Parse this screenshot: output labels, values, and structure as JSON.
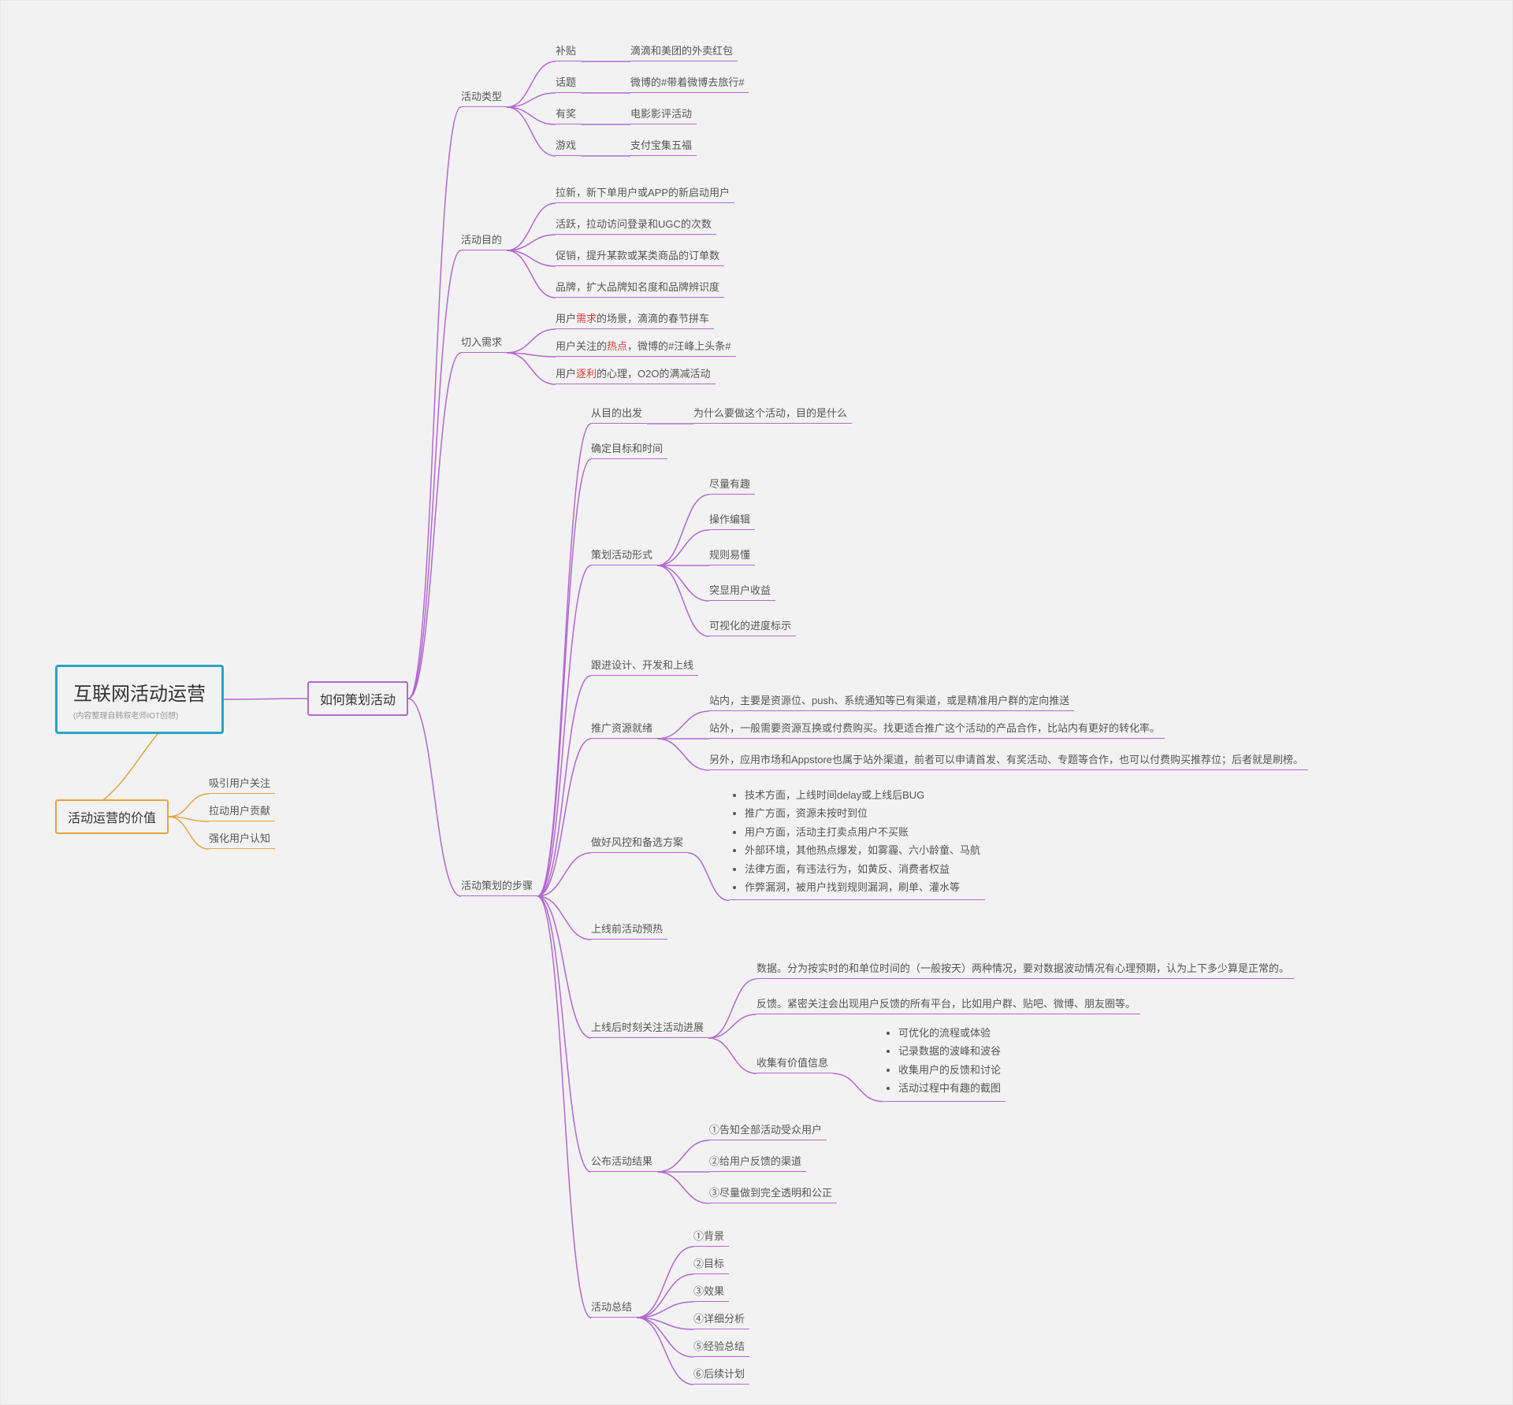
{
  "root": {
    "title": "互联网活动运营",
    "subtitle": "(内容整理自韩叙老师IOT创想)"
  },
  "how": {
    "label": "如何策划活动",
    "type": {
      "label": "活动类型",
      "items": [
        {
          "k": "补贴",
          "v": "滴滴和美团的外卖红包"
        },
        {
          "k": "话题",
          "v": "微博的#带着微博去旅行#"
        },
        {
          "k": "有奖",
          "v": "电影影评活动"
        },
        {
          "k": "游戏",
          "v": "支付宝集五福"
        }
      ]
    },
    "purpose": {
      "label": "活动目的",
      "items": [
        "拉新，新下单用户或APP的新启动用户",
        "活跃，拉动访问登录和UGC的次数",
        "促销，提升某款或某类商品的订单数",
        "品牌，扩大品牌知名度和品牌辨识度"
      ]
    },
    "needs": {
      "label": "切入需求",
      "items": [
        {
          "pre": "用户",
          "hi": "需求",
          "post": "的场景，滴滴的春节拼车"
        },
        {
          "pre": "用户关注的",
          "hi": "热点",
          "post": "，微博的#汪峰上头条#"
        },
        {
          "pre": "用户",
          "hi": "逐利",
          "post": "的心理，O2O的满减活动"
        }
      ]
    },
    "steps": {
      "label": "活动策划的步骤",
      "from_goal": {
        "k": "从目的出发",
        "v": "为什么要做这个活动，目的是什么"
      },
      "target": "确定目标和时间",
      "form": {
        "label": "策划活动形式",
        "items": [
          "尽量有趣",
          "操作编辑",
          "规则易懂",
          "突显用户收益",
          "可视化的进度标示"
        ]
      },
      "dev": "跟进设计、开发和上线",
      "promo": {
        "label": "推广资源就绪",
        "items": [
          "站内，主要是资源位、push、系统通知等已有渠道，或是精准用户群的定向推送",
          "站外，一般需要资源互换或付费购买。找更适合推广这个活动的产品合作，比站内有更好的转化率。",
          "另外，应用市场和Appstore也属于站外渠道，前者可以申请首发、有奖活动、专题等合作，也可以付费购买推荐位；后者就是刷榜。"
        ]
      },
      "risk": {
        "label": "做好风控和备选方案",
        "bullets": [
          "技术方面，上线时间delay或上线后BUG",
          "推广方面，资源未按时到位",
          "用户方面，活动主打卖点用户不买账",
          "外部环境，其他热点爆发，如雾霾、六小龄童、马航",
          "法律方面，有违法行为，如黄反、消费者权益",
          "作弊漏洞，被用户找到规则漏洞，刷单、灌水等"
        ]
      },
      "preheat": "上线前活动预热",
      "monitor": {
        "label": "上线后时刻关注活动进展",
        "items": [
          "数据。分为按实时的和单位时间的（一般按天）两种情况，要对数据波动情况有心理预期，认为上下多少算是正常的。",
          "反馈。紧密关注会出现用户反馈的所有平台，比如用户群、贴吧、微博、朋友圈等。"
        ],
        "collect": {
          "label": "收集有价值信息",
          "bullets": [
            "可优化的流程或体验",
            "记录数据的波峰和波谷",
            "收集用户的反馈和讨论",
            "活动过程中有趣的截图"
          ]
        }
      },
      "announce": {
        "label": "公布活动结果",
        "items": [
          "①告知全部活动受众用户",
          "②给用户反馈的渠道",
          "③尽量做到完全透明和公正"
        ]
      },
      "summary": {
        "label": "活动总结",
        "items": [
          "①背景",
          "②目标",
          "③效果",
          "④详细分析",
          "⑤经验总结",
          "⑥后续计划"
        ]
      }
    }
  },
  "value": {
    "label": "活动运营的价值",
    "items": [
      "吸引用户关注",
      "拉动用户贡献",
      "强化用户认知"
    ]
  }
}
